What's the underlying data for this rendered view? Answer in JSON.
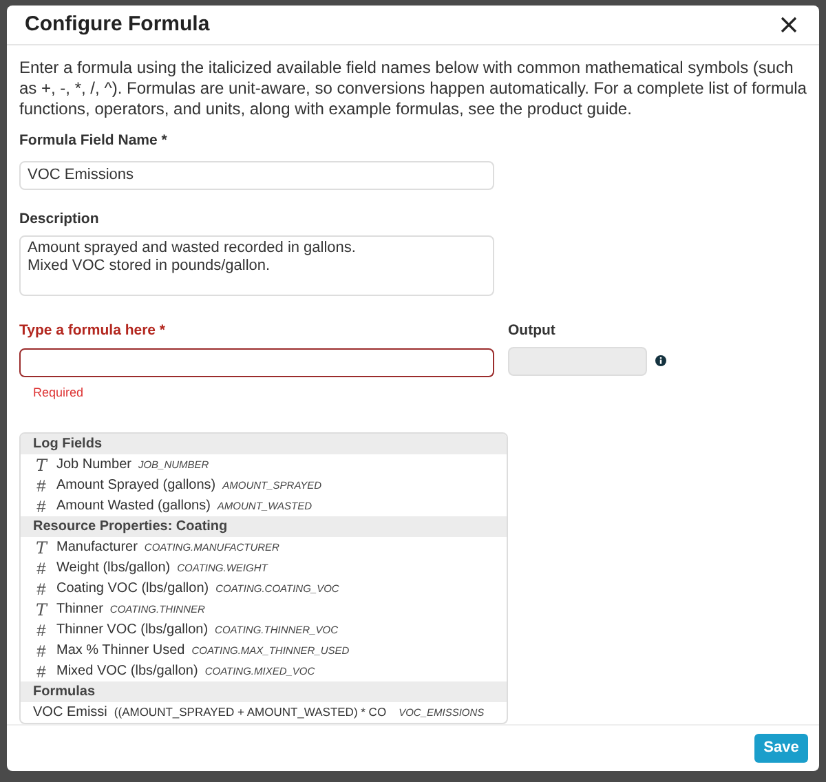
{
  "dialog": {
    "title": "Configure Formula",
    "intro": "Enter a formula using the italicized available field names below with common mathematical symbols (such as +, -, *, /, ^). Formulas are unit-aware, so conversions happen automatically. For a complete list of formula functions, operators, and units, along with example formulas, see the product guide."
  },
  "name_field": {
    "label": "Formula Field Name *",
    "value": "VOC Emissions"
  },
  "description_field": {
    "label": "Description",
    "value": "Amount sprayed and wasted recorded in gallons.\nMixed VOC stored in pounds/gallon."
  },
  "formula_field": {
    "label": "Type a formula here *",
    "invalid": true,
    "error": "Required"
  },
  "output_field": {
    "label": "Output",
    "disabled": true
  },
  "field_groups": [
    {
      "title": "Log Fields",
      "items": [
        {
          "kind": "text",
          "icon": "T",
          "name": "Job Number",
          "code": "JOB_NUMBER"
        },
        {
          "kind": "number",
          "icon": "#",
          "name": "Amount Sprayed (gallons)",
          "code": "AMOUNT_SPRAYED"
        },
        {
          "kind": "number",
          "icon": "#",
          "name": "Amount Wasted (gallons)",
          "code": "AMOUNT_WASTED"
        }
      ]
    },
    {
      "title": "Resource Properties: Coating",
      "items": [
        {
          "kind": "text",
          "icon": "T",
          "name": "Manufacturer",
          "code": "COATING.MANUFACTURER"
        },
        {
          "kind": "number",
          "icon": "#",
          "name": "Weight (lbs/gallon)",
          "code": "COATING.WEIGHT"
        },
        {
          "kind": "number",
          "icon": "#",
          "name": "Coating VOC (lbs/gallon)",
          "code": "COATING.COATING_VOC"
        },
        {
          "kind": "text",
          "icon": "T",
          "name": "Thinner",
          "code": "COATING.THINNER"
        },
        {
          "kind": "number",
          "icon": "#",
          "name": "Thinner VOC (lbs/gallon)",
          "code": "COATING.THINNER_VOC"
        },
        {
          "kind": "number",
          "icon": "#",
          "name": "Max % Thinner Used",
          "code": "COATING.MAX_THINNER_USED"
        },
        {
          "kind": "number",
          "icon": "#",
          "name": "Mixed VOC (lbs/gallon)",
          "code": "COATING.MIXED_VOC"
        }
      ]
    },
    {
      "title": "Formulas",
      "items": [
        {
          "kind": "formula",
          "name": "VOC Emissi",
          "formula": "((AMOUNT_SPRAYED + AMOUNT_WASTED) * CO",
          "code": "VOC_EMISSIONS"
        }
      ]
    }
  ],
  "save_button": "Save"
}
